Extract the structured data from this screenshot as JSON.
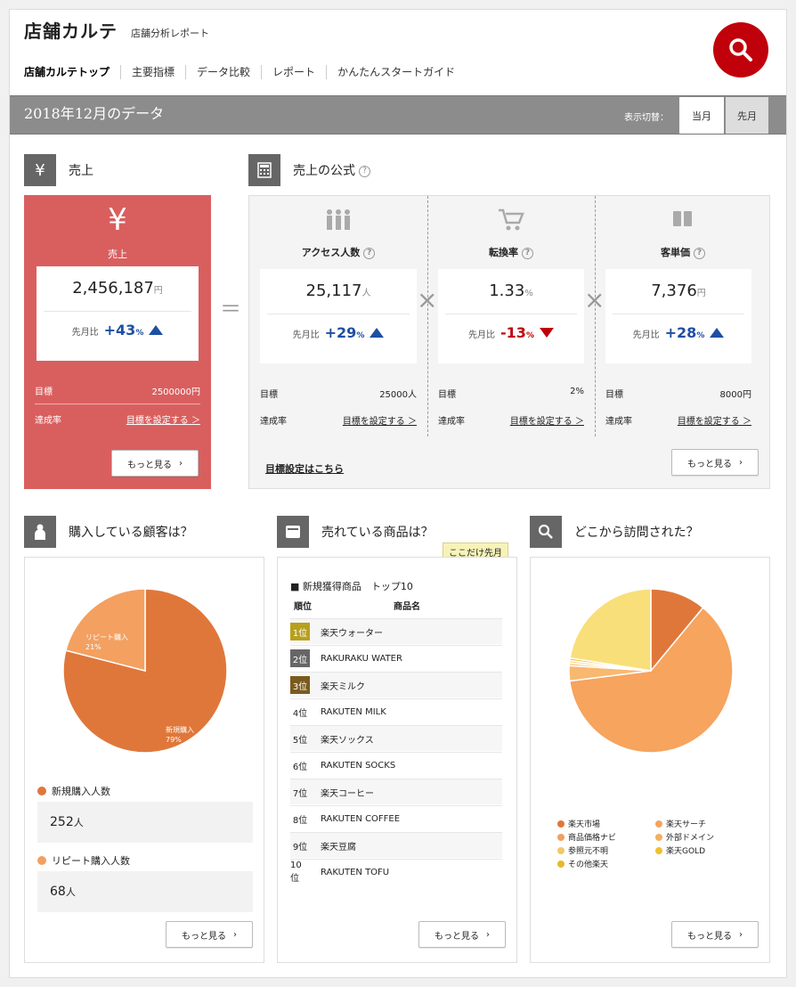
{
  "header": {
    "title": "店舗カルテ",
    "subtitle": "店舗分析レポート"
  },
  "nav": [
    "店舗カルテトップ",
    "主要指標",
    "データ比較",
    "レポート",
    "かんたんスタートガイド"
  ],
  "period": {
    "title": "2018年12月のデータ",
    "switch_label": "表示切替：",
    "current": "当月",
    "previous": "先月"
  },
  "sales": {
    "section_title": "売上",
    "label": "売上",
    "value": "2,456,187",
    "unit": "円",
    "compare_label": "先月比",
    "change": "+43",
    "change_unit": "%",
    "target_label": "目標",
    "target_value": "2500000円",
    "achieve_label": "達成率",
    "set_target": "目標を設定する ＞",
    "more": "もっと見る"
  },
  "formula": {
    "section_title": "売上の公式",
    "help": "?",
    "equals": "＝",
    "times": "×",
    "cols": [
      {
        "label": "アクセス人数",
        "value": "25,117",
        "unit": "人",
        "change": "+29",
        "change_unit": "%",
        "target": "25000人"
      },
      {
        "label": "転換率",
        "value": "1.33",
        "unit": "%",
        "change": "-13",
        "change_unit": "%",
        "target": "2%"
      },
      {
        "label": "客単価",
        "value": "7,376",
        "unit": "円",
        "change": "+28",
        "change_unit": "%",
        "target": "8000円"
      }
    ],
    "compare_label": "先月比",
    "target_label": "目標",
    "achieve_label": "達成率",
    "set_target": "目標を設定する ＞",
    "target_link": "目標設定はこちら",
    "more": "もっと見る"
  },
  "customers": {
    "title": "購入している顧客は？",
    "pie": [
      {
        "label": "新規購入",
        "pct": "79%",
        "value": 79,
        "color": "#e0773a"
      },
      {
        "label": "リピート購入",
        "pct": "21%",
        "value": 21,
        "color": "#f3a060"
      }
    ],
    "new_label": "新規購入人数",
    "new_value": "252",
    "repeat_label": "リピート購入人数",
    "repeat_value": "68",
    "unit": "人",
    "more": "もっと見る"
  },
  "products": {
    "title": "売れている商品は？",
    "tooltip": "ここだけ先月",
    "list_title": "■ 新規獲得商品　トップ10",
    "col_rank": "順位",
    "col_name": "商品名",
    "rows": [
      {
        "rank": "1位",
        "name": "楽天ウォーター",
        "badge": "#b8a01c"
      },
      {
        "rank": "2位",
        "name": "RAKURAKU WATER",
        "badge": "#666666"
      },
      {
        "rank": "3位",
        "name": "楽天ミルク",
        "badge": "#7a5a1e"
      },
      {
        "rank": "4位",
        "name": "RAKUTEN MILK",
        "badge": ""
      },
      {
        "rank": "5位",
        "name": "楽天ソックス",
        "badge": ""
      },
      {
        "rank": "6位",
        "name": "RAKUTEN SOCKS",
        "badge": ""
      },
      {
        "rank": "7位",
        "name": "楽天コーヒー",
        "badge": ""
      },
      {
        "rank": "8位",
        "name": "RAKUTEN COFFEE",
        "badge": ""
      },
      {
        "rank": "9位",
        "name": "楽天豆腐",
        "badge": ""
      },
      {
        "rank": "10位",
        "name": "RAKUTEN TOFU",
        "badge": ""
      }
    ],
    "more": "もっと見る"
  },
  "sources": {
    "title": "どこから訪問された？",
    "pie": [
      {
        "label": "楽天市場",
        "value": 11,
        "color": "#e0773a"
      },
      {
        "label": "楽天サーチ",
        "value": 62,
        "color": "#f6a45e"
      },
      {
        "label": "商品価格ナビ",
        "value": 3,
        "color": "#f8b870"
      },
      {
        "label": "外部ドメイン",
        "value": 0.5,
        "color": "#f8c578"
      },
      {
        "label": "参照元不明",
        "value": 0.5,
        "color": "#f8d890"
      },
      {
        "label": "楽天GOLD",
        "value": 0.5,
        "color": "#f2c14e"
      },
      {
        "label": "その他楽天",
        "value": 22.5,
        "color": "#f8df7a"
      }
    ],
    "legend_colors": [
      "#e0773a",
      "#f6a45e",
      "#f0a060",
      "#f2b060",
      "#f2c868",
      "#f0c030",
      "#e6b830"
    ],
    "more": "もっと見る"
  }
}
